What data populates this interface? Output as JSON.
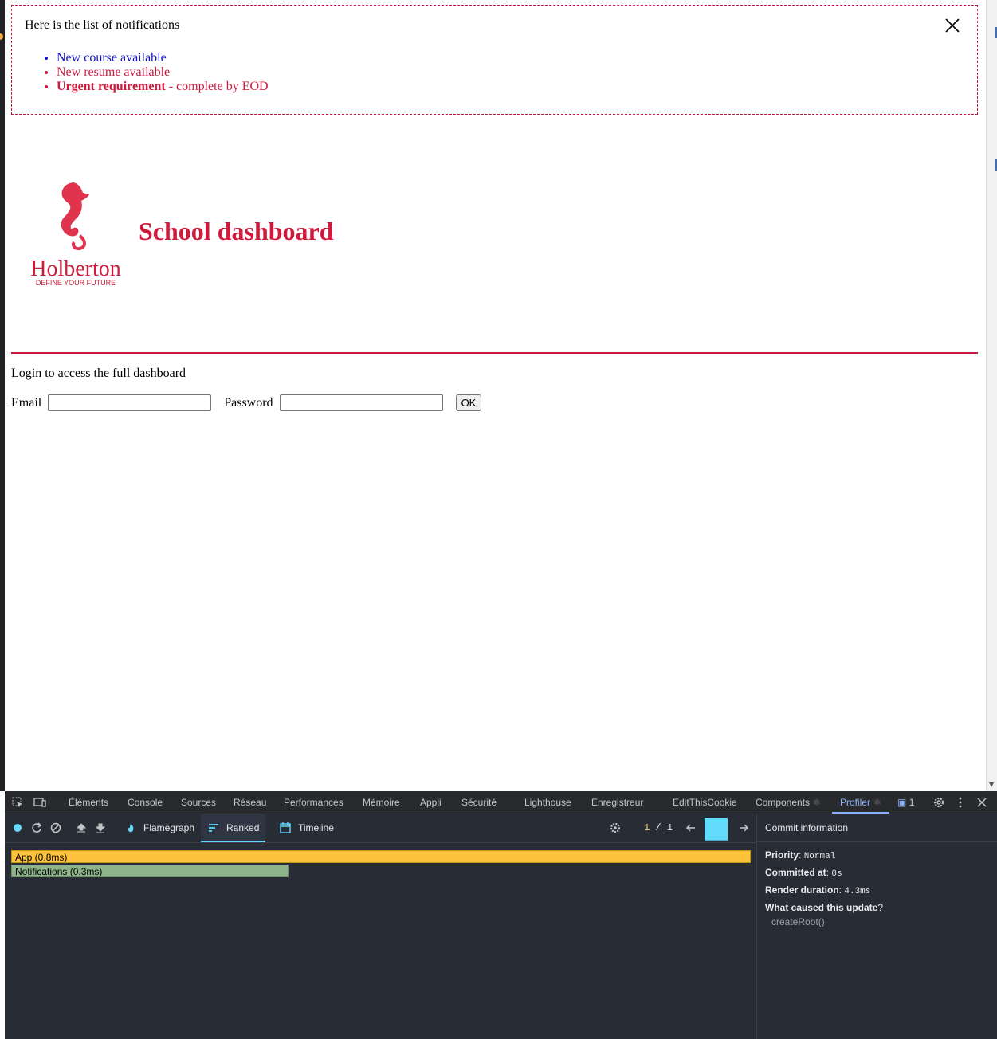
{
  "notifications": {
    "intro": "Here is the list of notifications",
    "items": [
      {
        "text": "New course available",
        "type": "default"
      },
      {
        "text": "New resume available",
        "type": "urgent"
      }
    ],
    "urgent_strong": "Urgent requirement",
    "urgent_rest": " - complete by EOD"
  },
  "header": {
    "title": "School dashboard",
    "logo_wordmark": "Holberton",
    "logo_tagline": "DEFINE YOUR FUTURE"
  },
  "login": {
    "message": "Login to access the full dashboard",
    "email_label": "Email",
    "password_label": "Password",
    "submit_label": "OK"
  },
  "devtools": {
    "tabs": [
      "Éléments",
      "Console",
      "Sources",
      "Réseau",
      "Performances",
      "Mémoire",
      "Appli",
      "Sécurité",
      "Lighthouse",
      "Enregistreur",
      "EditThisCookie",
      "Components",
      "Profiler"
    ],
    "active_tab": "Profiler",
    "issues_count": "1",
    "profiler": {
      "views": [
        "Flamegraph",
        "Ranked",
        "Timeline"
      ],
      "active_view": "Ranked",
      "commit_current": "1",
      "commit_total": "1",
      "ranked_bars": [
        {
          "label": "App (0.8ms)"
        },
        {
          "label": "Notifications (0.3ms)"
        }
      ],
      "commit_info": {
        "header": "Commit information",
        "priority_label": "Priority",
        "priority_value": "Normal",
        "committed_label": "Committed at",
        "committed_value": "0s",
        "render_label": "Render duration",
        "render_value": "4.3ms",
        "cause_label": "What caused this update",
        "cause_value": "createRoot()"
      }
    }
  },
  "colors": {
    "brand": "#d01a3c",
    "link": "#1111cc",
    "app_bar": "#ffc23d",
    "notif_bar": "#8fb38a",
    "react_accent": "#61dafb"
  }
}
